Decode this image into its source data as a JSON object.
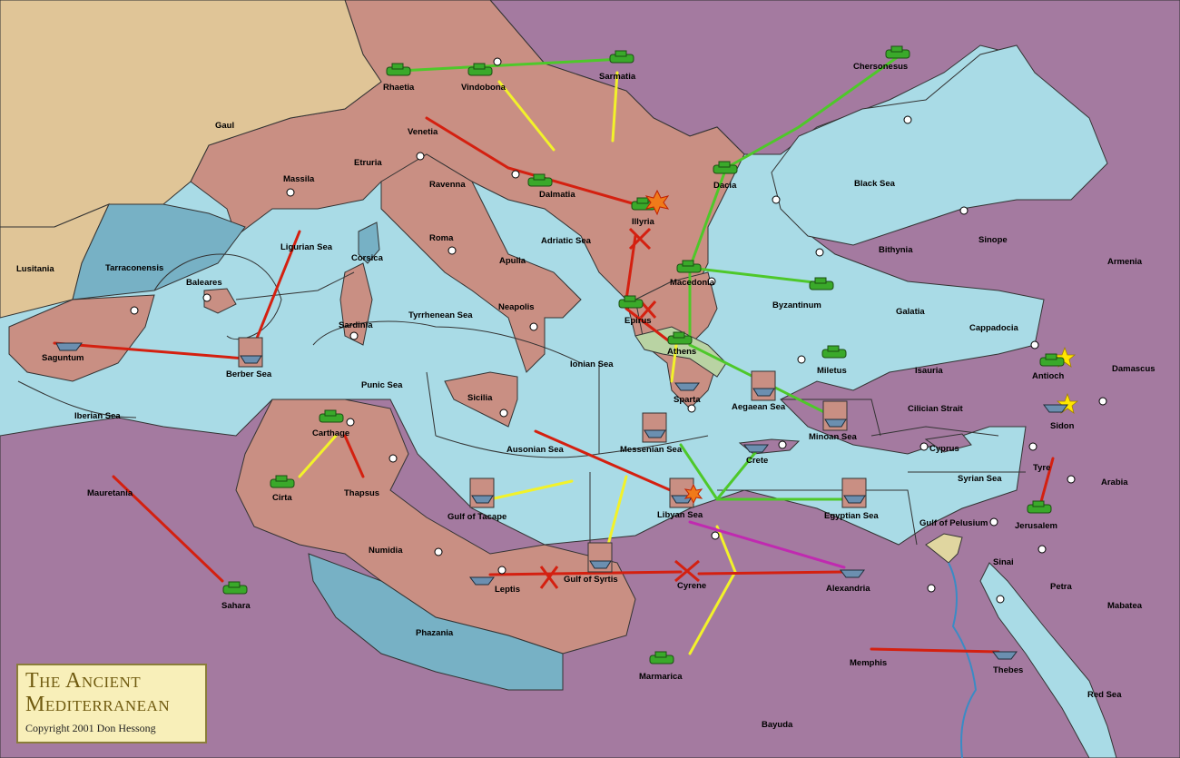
{
  "cartouche": {
    "title_line1": "The Ancient",
    "title_line2": "Mediterranean",
    "copyright": "Copyright  2001  Don Hessong"
  },
  "colors": {
    "sea": "#a9dbe6",
    "deep_sea": "#77b1c5",
    "neutral_land": "#e0c597",
    "red_power_land": "#c98f83",
    "purple_power_land": "#a47aa0",
    "athens_highlight": "#b9d3a3",
    "move_red": "#d42010",
    "move_yellow": "#f2f22a",
    "move_green": "#4ec82a",
    "move_magenta": "#c02ab0"
  },
  "labels": [
    {
      "id": "gaul",
      "text": "Gaul"
    },
    {
      "id": "lusitania",
      "text": "Lusitania"
    },
    {
      "id": "tarraconensis",
      "text": "Tarraconensis"
    },
    {
      "id": "massila",
      "text": "Massila"
    },
    {
      "id": "etruria",
      "text": "Etruria"
    },
    {
      "id": "rhaetia",
      "text": "Rhaetia"
    },
    {
      "id": "vindobona",
      "text": "Vindobona"
    },
    {
      "id": "sarmatia",
      "text": "Sarmatia"
    },
    {
      "id": "chersonesus",
      "text": "Chersonesus"
    },
    {
      "id": "venetia",
      "text": "Venetia"
    },
    {
      "id": "ravenna",
      "text": "Ravenna"
    },
    {
      "id": "dalmatia",
      "text": "Dalmatia"
    },
    {
      "id": "illyria",
      "text": "Illyria"
    },
    {
      "id": "dacia",
      "text": "Dacia"
    },
    {
      "id": "black_sea",
      "text": "Black Sea"
    },
    {
      "id": "ligurian_sea",
      "text": "Ligurian Sea"
    },
    {
      "id": "corsica",
      "text": "Corsica"
    },
    {
      "id": "roma",
      "text": "Roma"
    },
    {
      "id": "adriatic_sea",
      "text": "Adriatic Sea"
    },
    {
      "id": "apulia",
      "text": "Apulia"
    },
    {
      "id": "bithynia",
      "text": "Bithynia"
    },
    {
      "id": "sinope",
      "text": "Sinope"
    },
    {
      "id": "armenia",
      "text": "Armenia"
    },
    {
      "id": "baleares",
      "text": "Baleares"
    },
    {
      "id": "sardinia",
      "text": "Sardinia"
    },
    {
      "id": "tyrrhenean_sea",
      "text": "Tyrrhenean Sea"
    },
    {
      "id": "neapolis",
      "text": "Neapolis"
    },
    {
      "id": "macedonia",
      "text": "Macedonia"
    },
    {
      "id": "byzantinum",
      "text": "Byzantinum"
    },
    {
      "id": "galatia",
      "text": "Galatia"
    },
    {
      "id": "cappadocia",
      "text": "Cappadocia"
    },
    {
      "id": "saguntum",
      "text": "Saguntum"
    },
    {
      "id": "berber_sea",
      "text": "Berber Sea"
    },
    {
      "id": "epirus",
      "text": "Epirus"
    },
    {
      "id": "athens",
      "text": "Athens"
    },
    {
      "id": "ionian_sea",
      "text": "Ionian Sea"
    },
    {
      "id": "punic_sea",
      "text": "Punic Sea"
    },
    {
      "id": "miletus",
      "text": "Miletus"
    },
    {
      "id": "isauria",
      "text": "Isauria"
    },
    {
      "id": "antioch",
      "text": "Antioch"
    },
    {
      "id": "damascus",
      "text": "Damascus"
    },
    {
      "id": "iberian_sea",
      "text": "Iberian Sea"
    },
    {
      "id": "sicilia",
      "text": "Sicilia"
    },
    {
      "id": "sparta",
      "text": "Sparta"
    },
    {
      "id": "aegaean_sea",
      "text": "Aegaean Sea"
    },
    {
      "id": "cilician_strait",
      "text": "Cilician Strait"
    },
    {
      "id": "sidon",
      "text": "Sidon"
    },
    {
      "id": "carthage",
      "text": "Carthage"
    },
    {
      "id": "minoan_sea",
      "text": "Minoan Sea"
    },
    {
      "id": "ausonian_sea",
      "text": "Ausonian Sea"
    },
    {
      "id": "messenian_sea",
      "text": "Messenian Sea"
    },
    {
      "id": "crete",
      "text": "Crete"
    },
    {
      "id": "cyprus",
      "text": "Cyprus"
    },
    {
      "id": "tyre",
      "text": "Tyre"
    },
    {
      "id": "syrian_sea",
      "text": "Syrian Sea"
    },
    {
      "id": "arabia",
      "text": "Arabia"
    },
    {
      "id": "mauretania",
      "text": "Mauretania"
    },
    {
      "id": "cirta",
      "text": "Cirta"
    },
    {
      "id": "thapsus",
      "text": "Thapsus"
    },
    {
      "id": "gulf_of_tacape",
      "text": "Gulf of Tacape"
    },
    {
      "id": "libyan_sea",
      "text": "Libyan Sea"
    },
    {
      "id": "egyptian_sea",
      "text": "Egyptian Sea"
    },
    {
      "id": "gulf_of_pelusium",
      "text": "Gulf of Pelusium"
    },
    {
      "id": "jerusalem",
      "text": "Jerusalem"
    },
    {
      "id": "numidia",
      "text": "Numidia"
    },
    {
      "id": "sinai",
      "text": "Sinai"
    },
    {
      "id": "gulf_of_syrtis",
      "text": "Gulf of Syrtis"
    },
    {
      "id": "leptis",
      "text": "Leptis"
    },
    {
      "id": "cyrene",
      "text": "Cyrene"
    },
    {
      "id": "alexandria",
      "text": "Alexandria"
    },
    {
      "id": "petra",
      "text": "Petra"
    },
    {
      "id": "mabatea",
      "text": "Mabatea"
    },
    {
      "id": "sahara",
      "text": "Sahara"
    },
    {
      "id": "phazania",
      "text": "Phazania"
    },
    {
      "id": "memphis",
      "text": "Memphis"
    },
    {
      "id": "thebes",
      "text": "Thebes"
    },
    {
      "id": "marmarica",
      "text": "Marmarica"
    },
    {
      "id": "red_sea",
      "text": "Red Sea"
    },
    {
      "id": "bayuda",
      "text": "Bayuda"
    }
  ],
  "armies": [
    "rhaetia",
    "vindobona",
    "sarmatia",
    "chersonesus",
    "dalmatia",
    "illyria",
    "dacia",
    "macedonia",
    "byzantinum",
    "epirus",
    "athens",
    "miletus",
    "antioch",
    "carthage",
    "cirta",
    "jerusalem",
    "sahara",
    "marmarica"
  ],
  "fleets": [
    "saguntum",
    "sparta",
    "aegaean_sea",
    "minoan_sea",
    "crete",
    "sidon",
    "libyan_sea",
    "leptis",
    "alexandria",
    "thebes",
    "gulf_of_tacape",
    "gulf_of_syrtis",
    "egyptian_sea",
    "messenian_sea",
    "berber_sea"
  ],
  "supply_centers_star": [
    "antioch",
    "sidon"
  ],
  "combat_markers": [
    "illyria",
    "libyan_sea"
  ]
}
